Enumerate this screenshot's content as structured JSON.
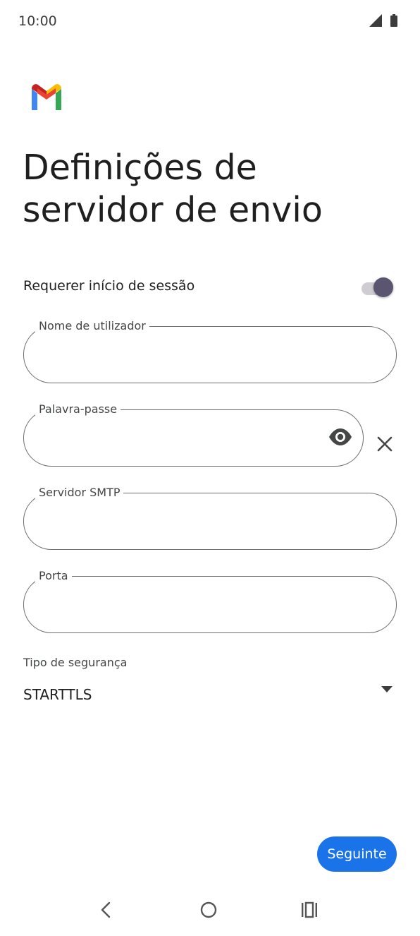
{
  "status_bar": {
    "time": "10:00",
    "icons": [
      "signal-icon",
      "battery-icon"
    ]
  },
  "app": {
    "logo": "gmail-logo"
  },
  "page": {
    "title": "Definições de servidor de envio"
  },
  "login_toggle": {
    "label": "Requerer início de sessão",
    "enabled": true
  },
  "fields": {
    "username": {
      "label": "Nome de utilizador",
      "value": ""
    },
    "password": {
      "label": "Palavra-passe",
      "value": ""
    },
    "smtp_server": {
      "label": "Servidor SMTP",
      "value": ""
    },
    "port": {
      "label": "Porta",
      "value": ""
    }
  },
  "security": {
    "caption": "Tipo de segurança",
    "selected": "STARTTLS"
  },
  "actions": {
    "next_label": "Seguinte"
  },
  "nav": {
    "back": "back-icon",
    "home": "home-icon",
    "recents": "recents-icon"
  },
  "colors": {
    "accent": "#1a73e8",
    "toggle_thumb": "#5b5570",
    "toggle_track": "#cfcdd3",
    "border": "#6f6f6f"
  }
}
